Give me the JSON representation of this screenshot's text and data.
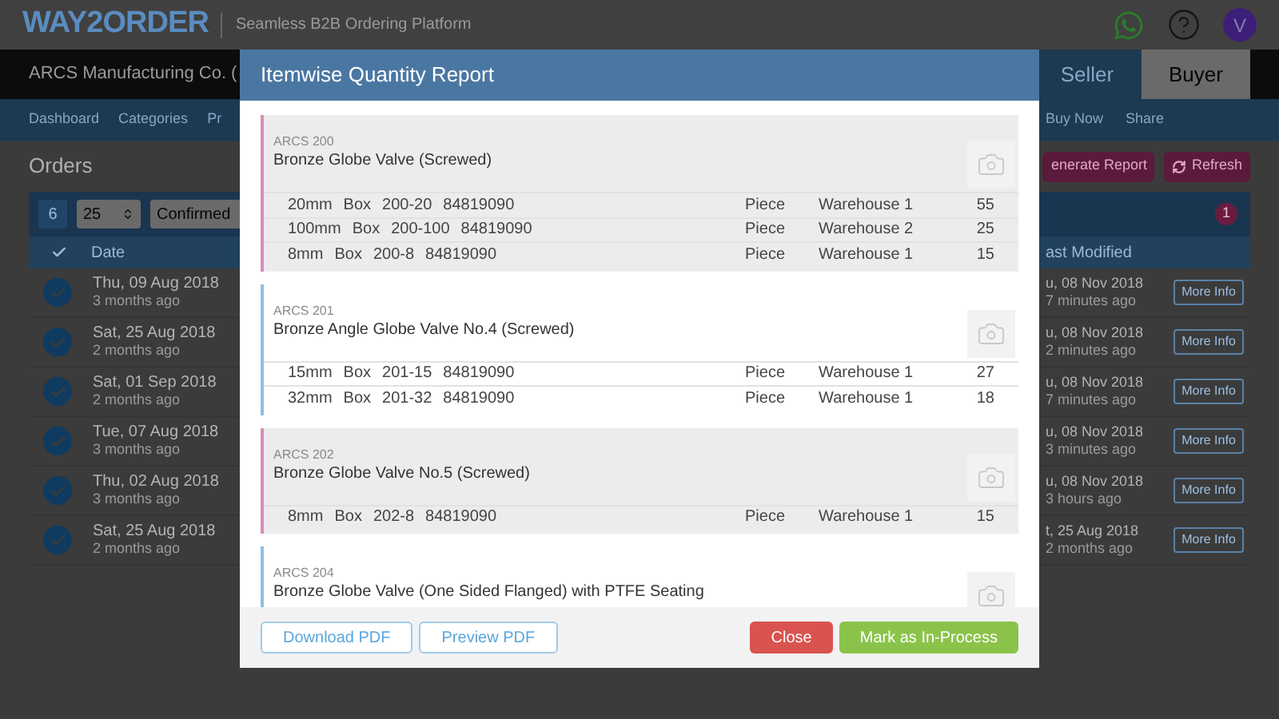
{
  "header": {
    "logo": "WAY2ORDER",
    "tagline": "Seamless B2B Ordering Platform",
    "avatar": "V"
  },
  "company_bar": {
    "name": "ARCS Manufacturing Co. (",
    "tabs": [
      {
        "label": "Seller",
        "selected": false
      },
      {
        "label": "Buyer",
        "selected": true
      }
    ]
  },
  "nav": {
    "left": [
      "Dashboard",
      "Categories",
      "Pr"
    ],
    "right": [
      "Buy Now",
      "Share"
    ]
  },
  "orders": {
    "title": "Orders",
    "buttons": [
      {
        "label": "enerate Report",
        "kind": "report"
      },
      {
        "label": "Refresh",
        "kind": "refresh"
      }
    ],
    "toolbar": {
      "count": "6",
      "page_size": "25",
      "status": "Confirmed",
      "badge": "1"
    },
    "columns": [
      "Date",
      "ast Modified"
    ],
    "rows": [
      {
        "date": "Thu, 09 Aug 2018",
        "date_ago": "3 months ago",
        "modified": "u, 08 Nov 2018",
        "modified_ago": "7 minutes ago",
        "checked": true,
        "action": "More Info"
      },
      {
        "date": "Sat, 25 Aug 2018",
        "date_ago": "2 months ago",
        "modified": "u, 08 Nov 2018",
        "modified_ago": "2 minutes ago",
        "checked": true,
        "action": "More Info"
      },
      {
        "date": "Sat, 01 Sep 2018",
        "date_ago": "2 months ago",
        "modified": "u, 08 Nov 2018",
        "modified_ago": "7 minutes ago",
        "checked": true,
        "action": "More Info"
      },
      {
        "date": "Tue, 07 Aug 2018",
        "date_ago": "3 months ago",
        "modified": "u, 08 Nov 2018",
        "modified_ago": "3 minutes ago",
        "checked": true,
        "action": "More Info"
      },
      {
        "date": "Thu, 02 Aug 2018",
        "date_ago": "3 months ago",
        "modified": "u, 08 Nov 2018",
        "modified_ago": "3 hours ago",
        "checked": true,
        "action": "More Info"
      },
      {
        "date": "Sat, 25 Aug 2018",
        "date_ago": "2 months ago",
        "modified": "t, 25 Aug 2018",
        "modified_ago": "2 months ago",
        "checked": true,
        "action": "More Info"
      }
    ]
  },
  "dialog": {
    "title": "Itemwise Quantity Report",
    "items": [
      {
        "code": "ARCS 200",
        "name": "Bronze Globe Valve (Screwed)",
        "color": "#d98cb8",
        "shaded": true,
        "lines": [
          {
            "size": "20mm",
            "pack": "Box",
            "sku": "200-20",
            "hsn": "84819090",
            "unit": "Piece",
            "warehouse": "Warehouse 1",
            "qty": "55"
          },
          {
            "size": "100mm",
            "pack": "Box",
            "sku": "200-100",
            "hsn": "84819090",
            "unit": "Piece",
            "warehouse": "Warehouse 2",
            "qty": "25"
          },
          {
            "size": "8mm",
            "pack": "Box",
            "sku": "200-8",
            "hsn": "84819090",
            "unit": "Piece",
            "warehouse": "Warehouse 1",
            "qty": "15"
          }
        ]
      },
      {
        "code": "ARCS 201",
        "name": "Bronze Angle Globe Valve No.4 (Screwed)",
        "color": "#8fc0e3",
        "shaded": false,
        "lines": [
          {
            "size": "15mm",
            "pack": "Box",
            "sku": "201-15",
            "hsn": "84819090",
            "unit": "Piece",
            "warehouse": "Warehouse 1",
            "qty": "27"
          },
          {
            "size": "32mm",
            "pack": "Box",
            "sku": "201-32",
            "hsn": "84819090",
            "unit": "Piece",
            "warehouse": "Warehouse 1",
            "qty": "18"
          }
        ]
      },
      {
        "code": "ARCS 202",
        "name": "Bronze Globe Valve No.5 (Screwed)",
        "color": "#d98cb8",
        "shaded": true,
        "lines": [
          {
            "size": "8mm",
            "pack": "Box",
            "sku": "202-8",
            "hsn": "84819090",
            "unit": "Piece",
            "warehouse": "Warehouse 1",
            "qty": "15"
          }
        ]
      },
      {
        "code": "ARCS 204",
        "name": "Bronze Globe Valve (One Sided Flanged) with PTFE Seating",
        "color": "#8fc0e3",
        "shaded": false
      }
    ],
    "footer_buttons": [
      {
        "label": "Download PDF",
        "kind": "outline"
      },
      {
        "label": "Preview PDF",
        "kind": "outline"
      },
      {
        "label": "Close",
        "kind": "danger"
      },
      {
        "label": "Mark as In-Process",
        "kind": "success"
      }
    ]
  }
}
